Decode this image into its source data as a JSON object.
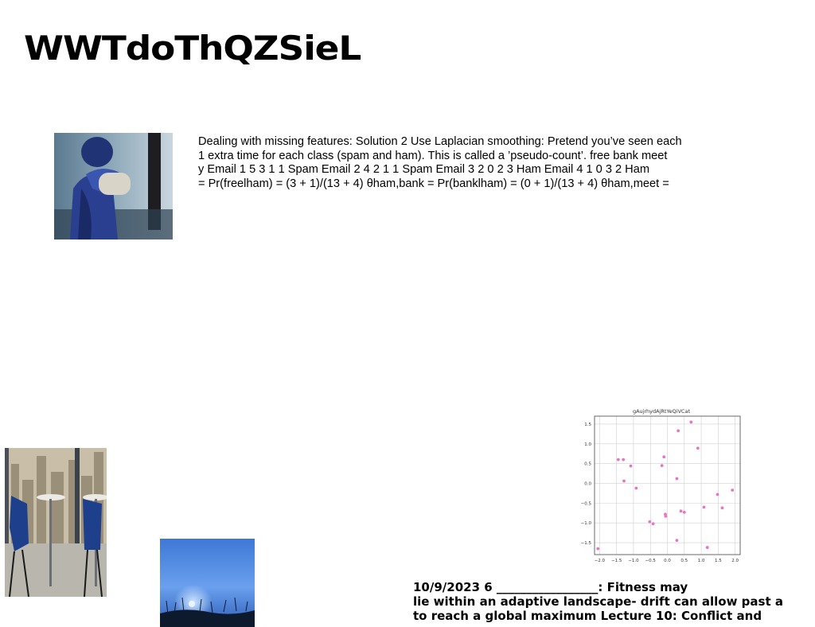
{
  "slide": {
    "title": "WWTdoThQZSieL",
    "body_lines": [
      "Dealing with missing features: Solution 2 Use Laplacian smoothing: Pretend you’ve seen each",
      "1 extra time for each class (spam and ham). This is called a ’pseudo-count’. free bank meet",
      "y Email 1 5 3 1 1 Spam Email 2 4 2 1 1 Spam Email 3 2 0 2 3 Ham Email 4 1 0 3 2 Ham",
      "= Pr(freelham) = (3 + 1)/(13 + 4) θham,bank = Pr(banklham) = (0 + 1)/(13 + 4) θham,meet ="
    ],
    "footer_lines": [
      "10/9/2023 6 _________________: Fitness may",
      "lie within an adaptive landscape- drift can allow past a",
      "to reach a global maximum Lecture 10: Conflict and"
    ]
  },
  "images": {
    "boxer": "boxer-photo",
    "cafe": "cafe-window-photo",
    "dusk": "dusk-field-photo"
  },
  "chart_data": {
    "type": "scatter",
    "title": "gAujrhydAjRtYeQiVCat",
    "color": "#e377c2",
    "xlim": [
      -2.15,
      2.15
    ],
    "ylim": [
      -1.8,
      1.7
    ],
    "xticks": [
      "−2.0",
      "−1.5",
      "−1.0",
      "−0.5",
      "0.0",
      "0.5",
      "1.0",
      "1.5",
      "2.0"
    ],
    "yticks": [
      "1.5",
      "1.0",
      "0.5",
      "0.0",
      "−0.5",
      "−1.0",
      "−1.5"
    ],
    "grid": true,
    "points": [
      {
        "x": -2.05,
        "y": -1.65
      },
      {
        "x": -1.45,
        "y": 0.6
      },
      {
        "x": -1.3,
        "y": 0.6
      },
      {
        "x": -1.28,
        "y": 0.06
      },
      {
        "x": -1.08,
        "y": 0.44
      },
      {
        "x": -0.92,
        "y": -0.12
      },
      {
        "x": -0.52,
        "y": -0.97
      },
      {
        "x": -0.42,
        "y": -1.02
      },
      {
        "x": -0.16,
        "y": 0.45
      },
      {
        "x": -0.1,
        "y": 0.67
      },
      {
        "x": -0.06,
        "y": -0.78
      },
      {
        "x": -0.05,
        "y": -0.83
      },
      {
        "x": 0.28,
        "y": 0.12
      },
      {
        "x": 0.28,
        "y": -1.44
      },
      {
        "x": 0.32,
        "y": 1.33
      },
      {
        "x": 0.4,
        "y": -0.7
      },
      {
        "x": 0.5,
        "y": -0.73
      },
      {
        "x": 0.7,
        "y": 1.55
      },
      {
        "x": 0.9,
        "y": 0.89
      },
      {
        "x": 1.08,
        "y": -0.6
      },
      {
        "x": 1.18,
        "y": -1.62
      },
      {
        "x": 1.48,
        "y": -0.28
      },
      {
        "x": 1.62,
        "y": -0.62
      },
      {
        "x": 1.92,
        "y": -0.17
      }
    ]
  }
}
